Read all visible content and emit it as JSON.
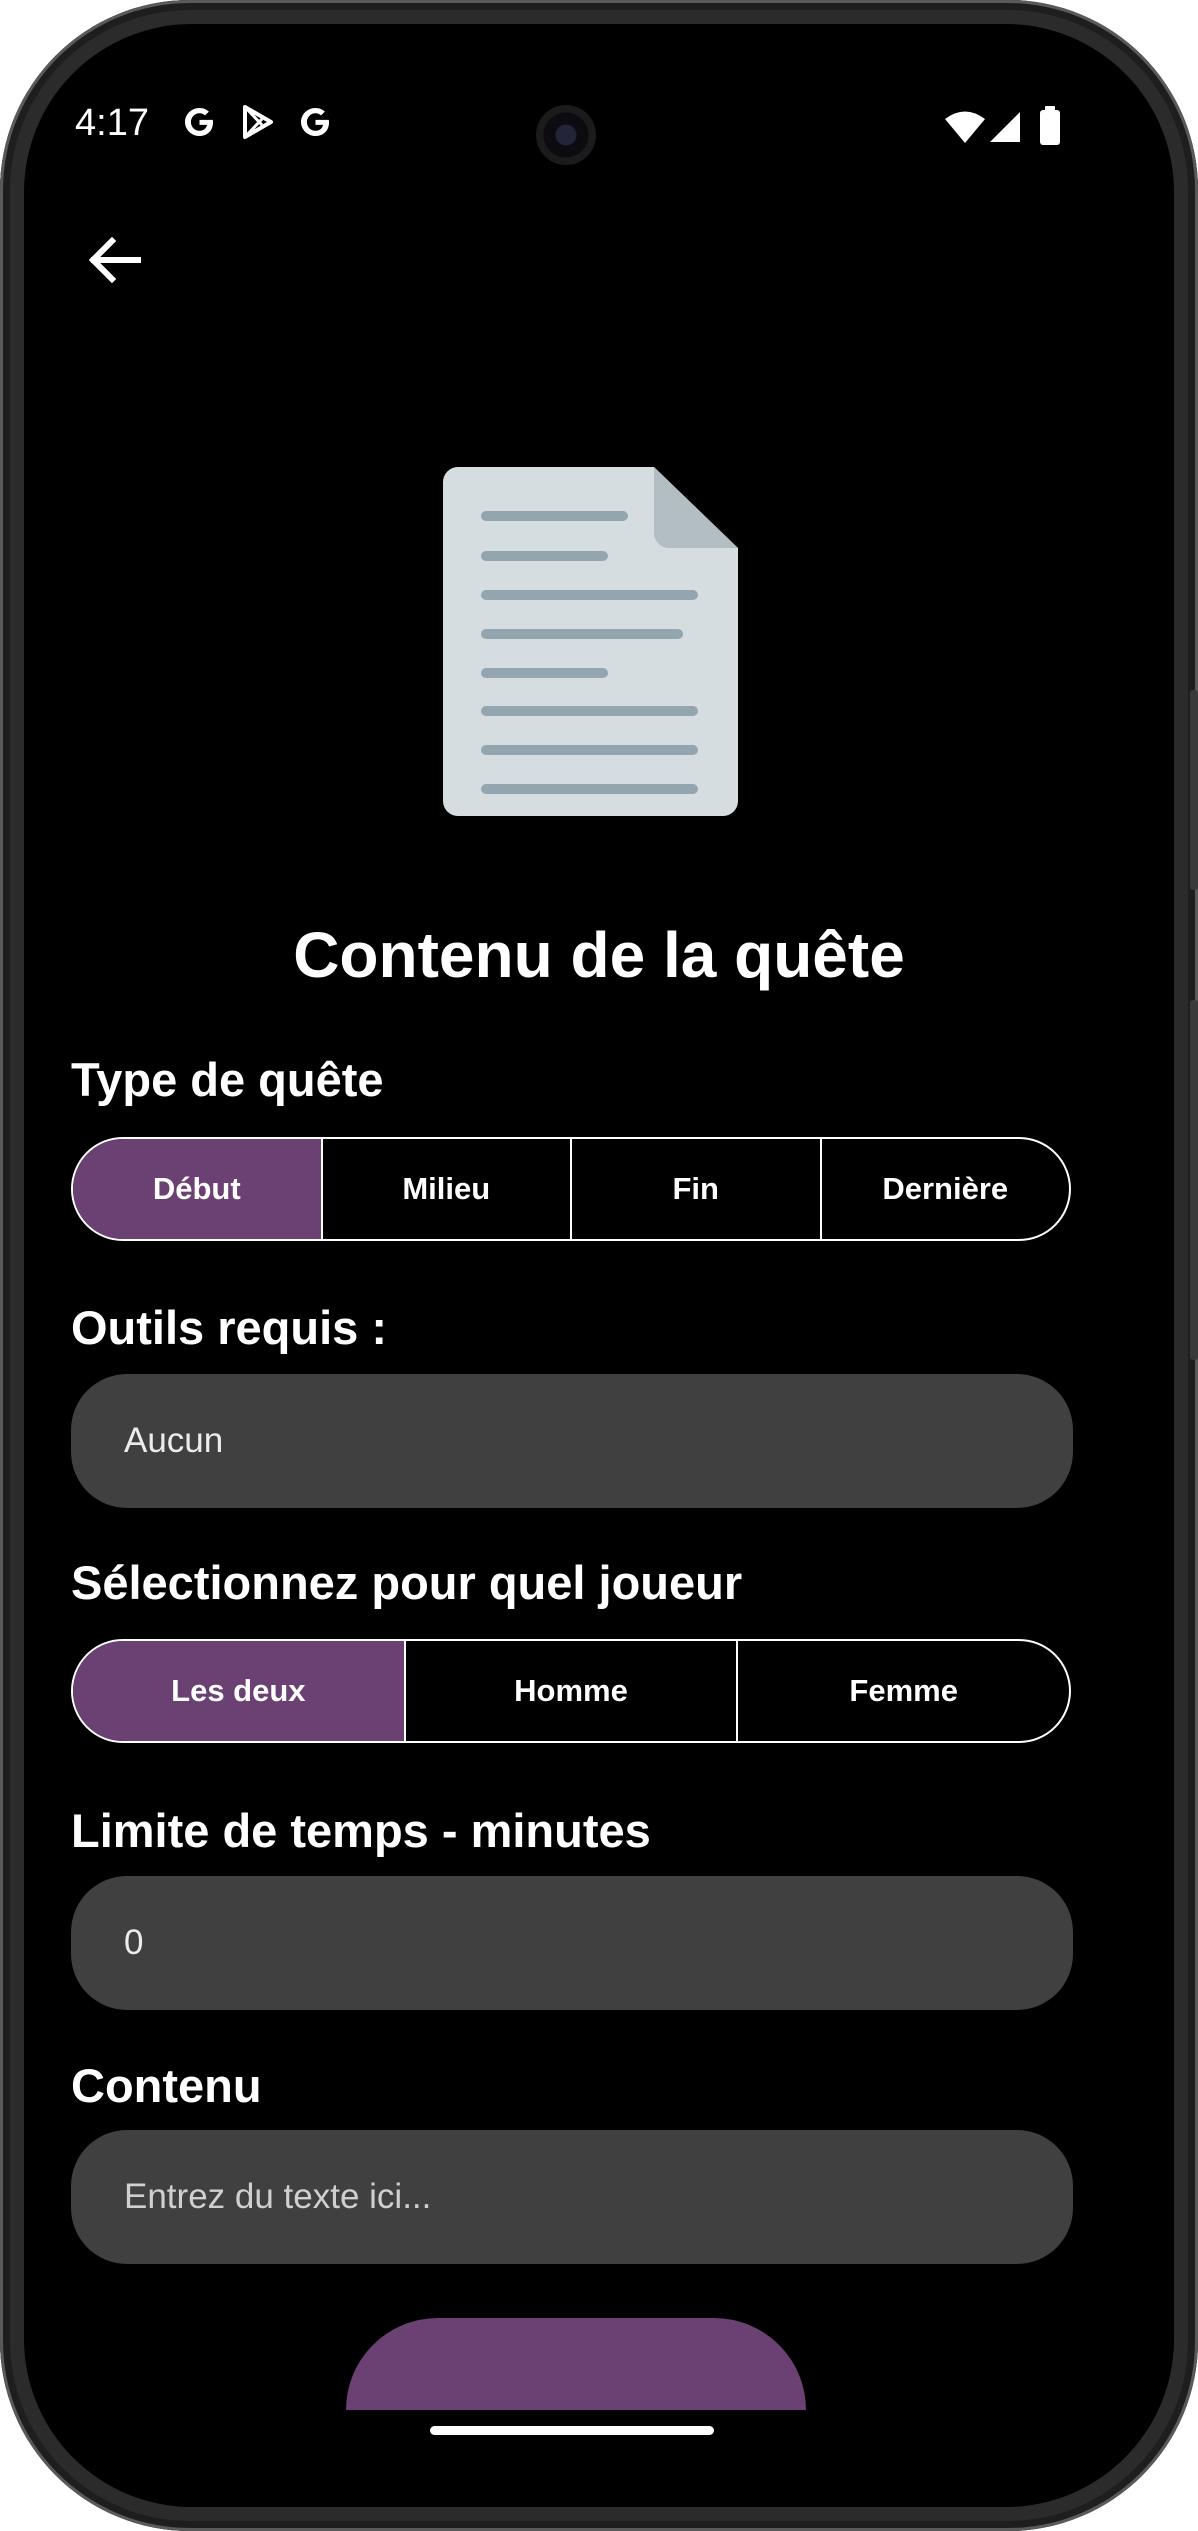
{
  "status_bar": {
    "time": "4:17",
    "left_icons": [
      "google-g-icon",
      "play-store-icon",
      "google-g-icon"
    ],
    "right_icons": [
      "wifi-icon",
      "cellular-signal-icon",
      "battery-icon"
    ]
  },
  "header": {
    "back_icon": "back-arrow-icon"
  },
  "hero_icon": "document-icon",
  "title": "Contenu de la quête",
  "quest_type": {
    "label": "Type de quête",
    "options": [
      "Début",
      "Milieu",
      "Fin",
      "Dernière"
    ],
    "selected": "Début"
  },
  "tools": {
    "label": "Outils requis :",
    "value": "Aucun"
  },
  "player": {
    "label": "Sélectionnez pour quel joueur",
    "options": [
      "Les deux",
      "Homme",
      "Femme"
    ],
    "selected": "Les deux"
  },
  "time_limit": {
    "label": "Limite de temps - minutes",
    "value": "0"
  },
  "content": {
    "label": "Contenu",
    "placeholder": "Entrez du texte ici..."
  },
  "colors": {
    "accent": "#6a4172",
    "background": "#000000",
    "field_background": "#404040",
    "document_page": "#d6dde0",
    "document_lines": "#93a5ae"
  }
}
